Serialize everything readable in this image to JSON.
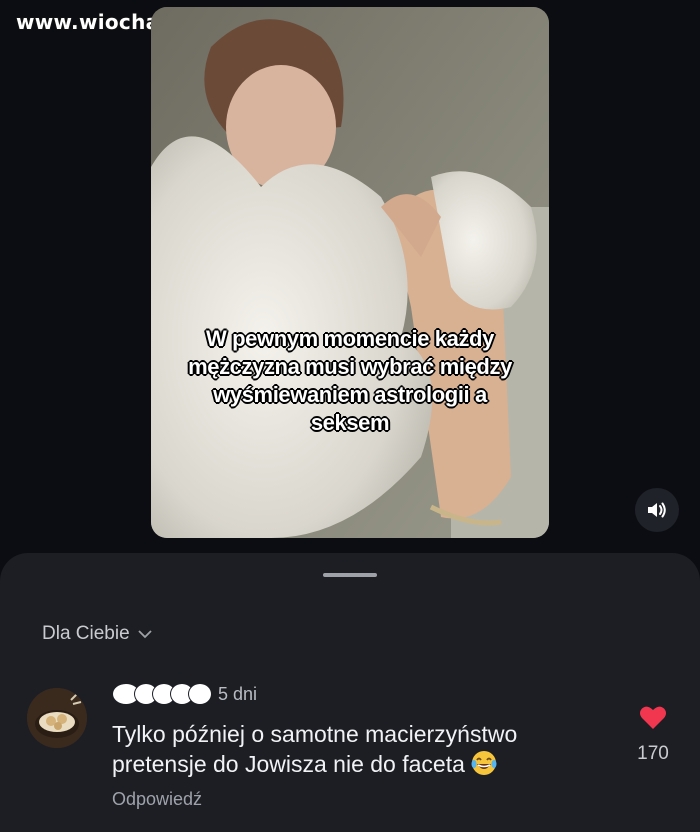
{
  "watermark": "www.wiocha.pl",
  "video": {
    "caption_lines": [
      "W pewnym momencie każdy",
      "mężczyzna musi wybrać między",
      "wyśmiewaniem astrologii a",
      "seksem"
    ],
    "sound_icon": "speaker-on-icon"
  },
  "comments_sheet": {
    "filter_label": "Dla Ciebie",
    "comment": {
      "time": "5 dni",
      "text": "Tylko później o samotne macierzyństwo pretensje do Jowisza nie do faceta",
      "emoji": "laughing-tears-emoji",
      "reply_label": "Odpowiedź",
      "likes": "170"
    }
  },
  "colors": {
    "background": "#0b0d12",
    "sheet": "#1c1e24",
    "like_heart": "#f0374f"
  }
}
